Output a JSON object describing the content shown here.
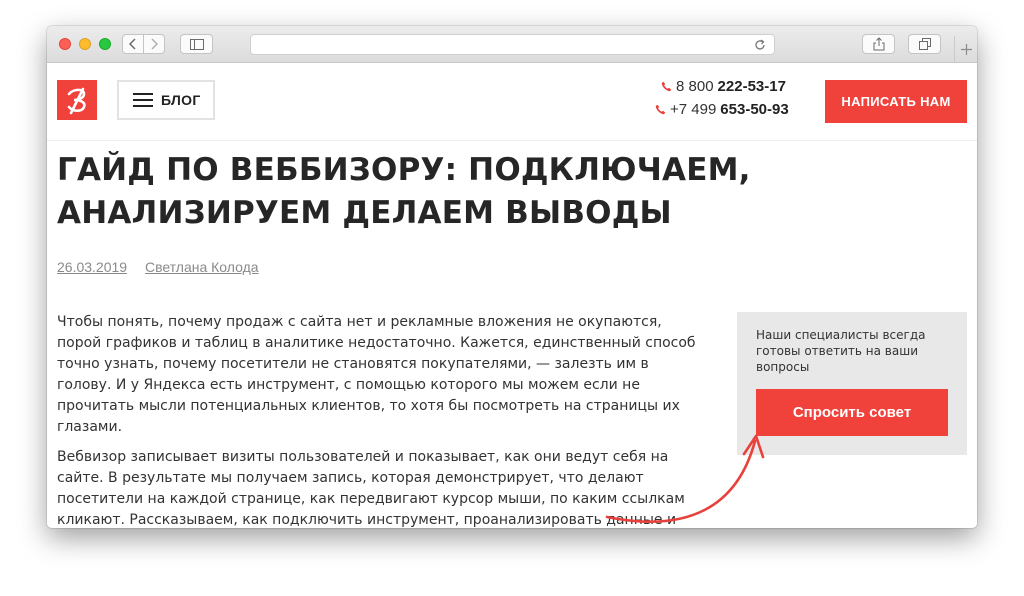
{
  "header": {
    "blog_label": "БЛОГ",
    "phones": [
      {
        "prefix": "8 800",
        "number": "222-53-17"
      },
      {
        "prefix": "+7 499",
        "number": "653-50-93"
      }
    ],
    "write_button": "НАПИСАТЬ НАМ"
  },
  "article": {
    "title": "ГАЙД ПО ВЕББИЗОРУ: ПОДКЛЮЧАЕМ, АНАЛИЗИРУЕМ ДЕЛАЕМ ВЫВОДЫ",
    "date": "26.03.2019",
    "author": "Светлана Колода",
    "paragraph1": "Чтобы понять, почему продаж с сайта нет и рекламные вложения не окупаются, порой графиков и таблиц в аналитике недостаточно. Кажется, единственный способ точно узнать, почему посетители не становятся покупателями, — залезть им в голову. И у Яндекса есть инструмент, с помощью которого мы можем если не прочитать мысли потенциальных клиентов, то хотя бы посмотреть на страницы их глазами.",
    "paragraph2": "Вебвизор записывает визиты пользователей и показывает, как они ведут себя на сайте. В результате мы получаем запись, которая демонстрирует, что делают посетители на каждой странице, как передвигают курсор мыши, по каким ссылкам кликают. Рассказываем, как подключить инструмент, проанализировать данные и сделать правильные выводы."
  },
  "sidebar": {
    "text": "Наши специалисты всегда готовы ответить на ваши вопросы",
    "button": "Спросить совет"
  },
  "colors": {
    "accent": "#f1413b",
    "sidebar_bg": "#e8e8e8"
  },
  "icons": [
    "back-icon",
    "forward-icon",
    "sidebar-toggle-icon",
    "reload-icon",
    "share-icon",
    "tabs-icon",
    "new-tab-icon",
    "logo-icon",
    "menu-icon",
    "phone-icon",
    "arrow-annotation"
  ]
}
